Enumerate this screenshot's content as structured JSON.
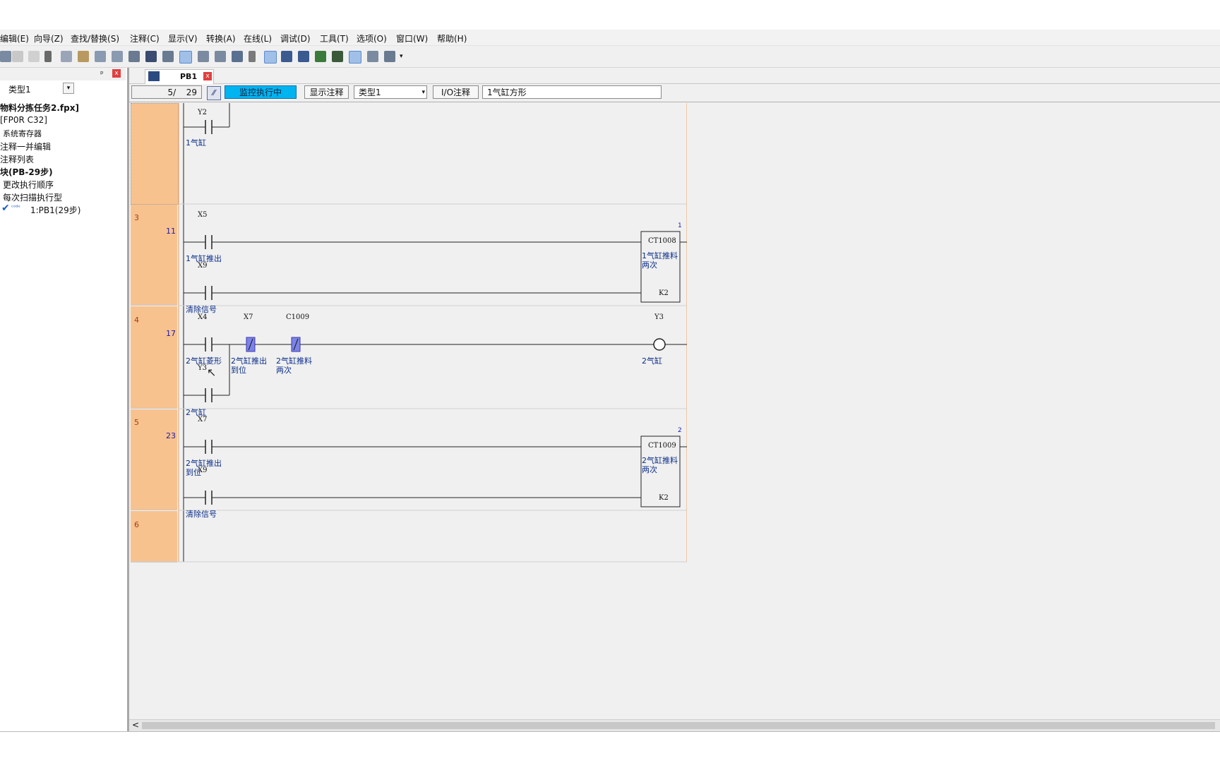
{
  "menu": [
    "编辑(E)",
    "向导(Z)",
    "查找/替换(S)",
    "注释(C)",
    "显示(V)",
    "转换(A)",
    "在线(L)",
    "调试(D)",
    "工具(T)",
    "选项(O)",
    "窗口(W)",
    "帮助(H)"
  ],
  "toolbar_icons": [
    "save-icon",
    "undo-icon",
    "redo-icon",
    "cut-icon",
    "copy-icon",
    "paste-icon",
    "insert-row-icon",
    "delete-row-icon",
    "jump-icon",
    "find-icon",
    "monitor-icon",
    "list-icon",
    "compare-icon",
    "convert-icon",
    "register-icon",
    "clear-icon",
    "bookmark-icon",
    "download-icon",
    "upload-icon",
    "run-icon",
    "monitor-window-icon",
    "display-icon",
    "more-icon"
  ],
  "colors": {
    "accent_monitor": "#00b4f0",
    "rung_bar": "#f8c28f",
    "comment": "#0b2e8a",
    "contact_active": "#7b83e6"
  },
  "left_panel": {
    "pin": "ᵖ",
    "close": "x",
    "type_select": "类型1",
    "tree": [
      "物料分拣任务2.fpx]",
      "[FP0R C32]",
      "系统寄存器",
      "注释一并编辑",
      "注释列表",
      "块(PB-29步)",
      "更改执行顺序",
      "每次扫描执行型",
      "1:PB1(29步)"
    ],
    "tree_prefix": "ᶜᵒᵈᵉ"
  },
  "tab": {
    "label": "PB1",
    "close": "x"
  },
  "infobar": {
    "step": "5/",
    "total": "29",
    "monitor": "监控执行中",
    "show_comment": "显示注释",
    "type": "类型1",
    "io_comment": "I/O注释",
    "io_value": "1气缸方形"
  },
  "rungs": [
    {
      "no": "",
      "step": "",
      "contacts": [
        {
          "dev": "Y2",
          "cmt": "1气缸"
        }
      ]
    },
    {
      "no": "3",
      "step": "11",
      "contacts": [
        {
          "dev": "X5",
          "cmt": "1气缸推出"
        },
        {
          "dev": "X9",
          "cmt": "清除信号"
        }
      ],
      "counter": {
        "index": "1",
        "name": "CT1008",
        "cmt1": "1气缸推料",
        "cmt2": "两次",
        "preset": "K2"
      }
    },
    {
      "no": "4",
      "step": "17",
      "contacts": [
        {
          "dev": "X4",
          "cmt": "2气缸菱形"
        },
        {
          "dev": "X7",
          "cmt1": "2气缸推出",
          "cmt2": "到位"
        },
        {
          "dev": "C1009",
          "cmt1": "2气缸推料",
          "cmt2": "两次"
        },
        {
          "dev": "Y3",
          "cmt": "2气缸"
        }
      ],
      "coil": {
        "dev": "Y3",
        "cmt": "2气缸"
      }
    },
    {
      "no": "5",
      "step": "23",
      "contacts": [
        {
          "dev": "X7",
          "cmt1": "2气缸推出",
          "cmt2": "到位"
        },
        {
          "dev": "X9",
          "cmt": "清除信号"
        }
      ],
      "counter": {
        "index": "2",
        "name": "CT1009",
        "cmt1": "2气缸推料",
        "cmt2": "两次",
        "preset": "K2"
      }
    },
    {
      "no": "6",
      "step": ""
    }
  ],
  "scroll_left": "<"
}
